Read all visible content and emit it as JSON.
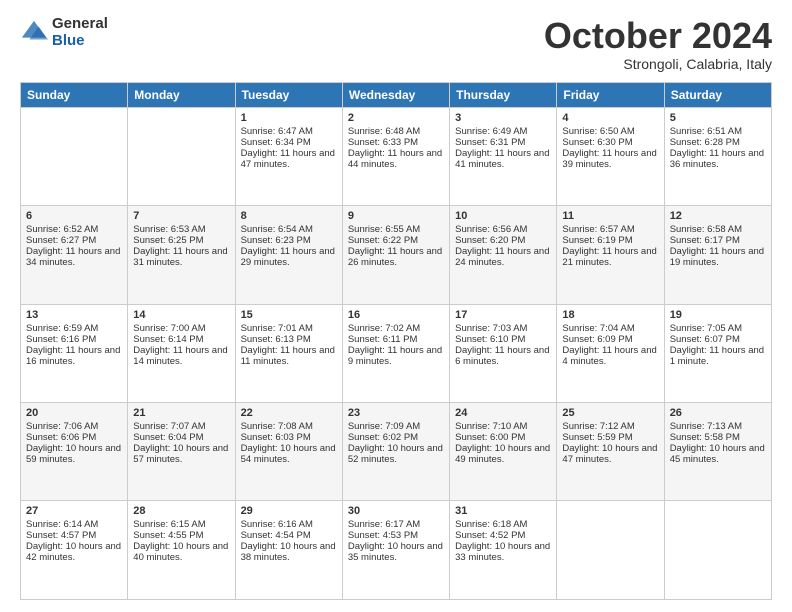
{
  "logo": {
    "general": "General",
    "blue": "Blue"
  },
  "header": {
    "month": "October 2024",
    "location": "Strongoli, Calabria, Italy"
  },
  "days": [
    "Sunday",
    "Monday",
    "Tuesday",
    "Wednesday",
    "Thursday",
    "Friday",
    "Saturday"
  ],
  "weeks": [
    [
      {
        "day": "",
        "content": ""
      },
      {
        "day": "",
        "content": ""
      },
      {
        "day": "1",
        "content": "Sunrise: 6:47 AM\nSunset: 6:34 PM\nDaylight: 11 hours and 47 minutes."
      },
      {
        "day": "2",
        "content": "Sunrise: 6:48 AM\nSunset: 6:33 PM\nDaylight: 11 hours and 44 minutes."
      },
      {
        "day": "3",
        "content": "Sunrise: 6:49 AM\nSunset: 6:31 PM\nDaylight: 11 hours and 41 minutes."
      },
      {
        "day": "4",
        "content": "Sunrise: 6:50 AM\nSunset: 6:30 PM\nDaylight: 11 hours and 39 minutes."
      },
      {
        "day": "5",
        "content": "Sunrise: 6:51 AM\nSunset: 6:28 PM\nDaylight: 11 hours and 36 minutes."
      }
    ],
    [
      {
        "day": "6",
        "content": "Sunrise: 6:52 AM\nSunset: 6:27 PM\nDaylight: 11 hours and 34 minutes."
      },
      {
        "day": "7",
        "content": "Sunrise: 6:53 AM\nSunset: 6:25 PM\nDaylight: 11 hours and 31 minutes."
      },
      {
        "day": "8",
        "content": "Sunrise: 6:54 AM\nSunset: 6:23 PM\nDaylight: 11 hours and 29 minutes."
      },
      {
        "day": "9",
        "content": "Sunrise: 6:55 AM\nSunset: 6:22 PM\nDaylight: 11 hours and 26 minutes."
      },
      {
        "day": "10",
        "content": "Sunrise: 6:56 AM\nSunset: 6:20 PM\nDaylight: 11 hours and 24 minutes."
      },
      {
        "day": "11",
        "content": "Sunrise: 6:57 AM\nSunset: 6:19 PM\nDaylight: 11 hours and 21 minutes."
      },
      {
        "day": "12",
        "content": "Sunrise: 6:58 AM\nSunset: 6:17 PM\nDaylight: 11 hours and 19 minutes."
      }
    ],
    [
      {
        "day": "13",
        "content": "Sunrise: 6:59 AM\nSunset: 6:16 PM\nDaylight: 11 hours and 16 minutes."
      },
      {
        "day": "14",
        "content": "Sunrise: 7:00 AM\nSunset: 6:14 PM\nDaylight: 11 hours and 14 minutes."
      },
      {
        "day": "15",
        "content": "Sunrise: 7:01 AM\nSunset: 6:13 PM\nDaylight: 11 hours and 11 minutes."
      },
      {
        "day": "16",
        "content": "Sunrise: 7:02 AM\nSunset: 6:11 PM\nDaylight: 11 hours and 9 minutes."
      },
      {
        "day": "17",
        "content": "Sunrise: 7:03 AM\nSunset: 6:10 PM\nDaylight: 11 hours and 6 minutes."
      },
      {
        "day": "18",
        "content": "Sunrise: 7:04 AM\nSunset: 6:09 PM\nDaylight: 11 hours and 4 minutes."
      },
      {
        "day": "19",
        "content": "Sunrise: 7:05 AM\nSunset: 6:07 PM\nDaylight: 11 hours and 1 minute."
      }
    ],
    [
      {
        "day": "20",
        "content": "Sunrise: 7:06 AM\nSunset: 6:06 PM\nDaylight: 10 hours and 59 minutes."
      },
      {
        "day": "21",
        "content": "Sunrise: 7:07 AM\nSunset: 6:04 PM\nDaylight: 10 hours and 57 minutes."
      },
      {
        "day": "22",
        "content": "Sunrise: 7:08 AM\nSunset: 6:03 PM\nDaylight: 10 hours and 54 minutes."
      },
      {
        "day": "23",
        "content": "Sunrise: 7:09 AM\nSunset: 6:02 PM\nDaylight: 10 hours and 52 minutes."
      },
      {
        "day": "24",
        "content": "Sunrise: 7:10 AM\nSunset: 6:00 PM\nDaylight: 10 hours and 49 minutes."
      },
      {
        "day": "25",
        "content": "Sunrise: 7:12 AM\nSunset: 5:59 PM\nDaylight: 10 hours and 47 minutes."
      },
      {
        "day": "26",
        "content": "Sunrise: 7:13 AM\nSunset: 5:58 PM\nDaylight: 10 hours and 45 minutes."
      }
    ],
    [
      {
        "day": "27",
        "content": "Sunrise: 6:14 AM\nSunset: 4:57 PM\nDaylight: 10 hours and 42 minutes."
      },
      {
        "day": "28",
        "content": "Sunrise: 6:15 AM\nSunset: 4:55 PM\nDaylight: 10 hours and 40 minutes."
      },
      {
        "day": "29",
        "content": "Sunrise: 6:16 AM\nSunset: 4:54 PM\nDaylight: 10 hours and 38 minutes."
      },
      {
        "day": "30",
        "content": "Sunrise: 6:17 AM\nSunset: 4:53 PM\nDaylight: 10 hours and 35 minutes."
      },
      {
        "day": "31",
        "content": "Sunrise: 6:18 AM\nSunset: 4:52 PM\nDaylight: 10 hours and 33 minutes."
      },
      {
        "day": "",
        "content": ""
      },
      {
        "day": "",
        "content": ""
      }
    ]
  ]
}
